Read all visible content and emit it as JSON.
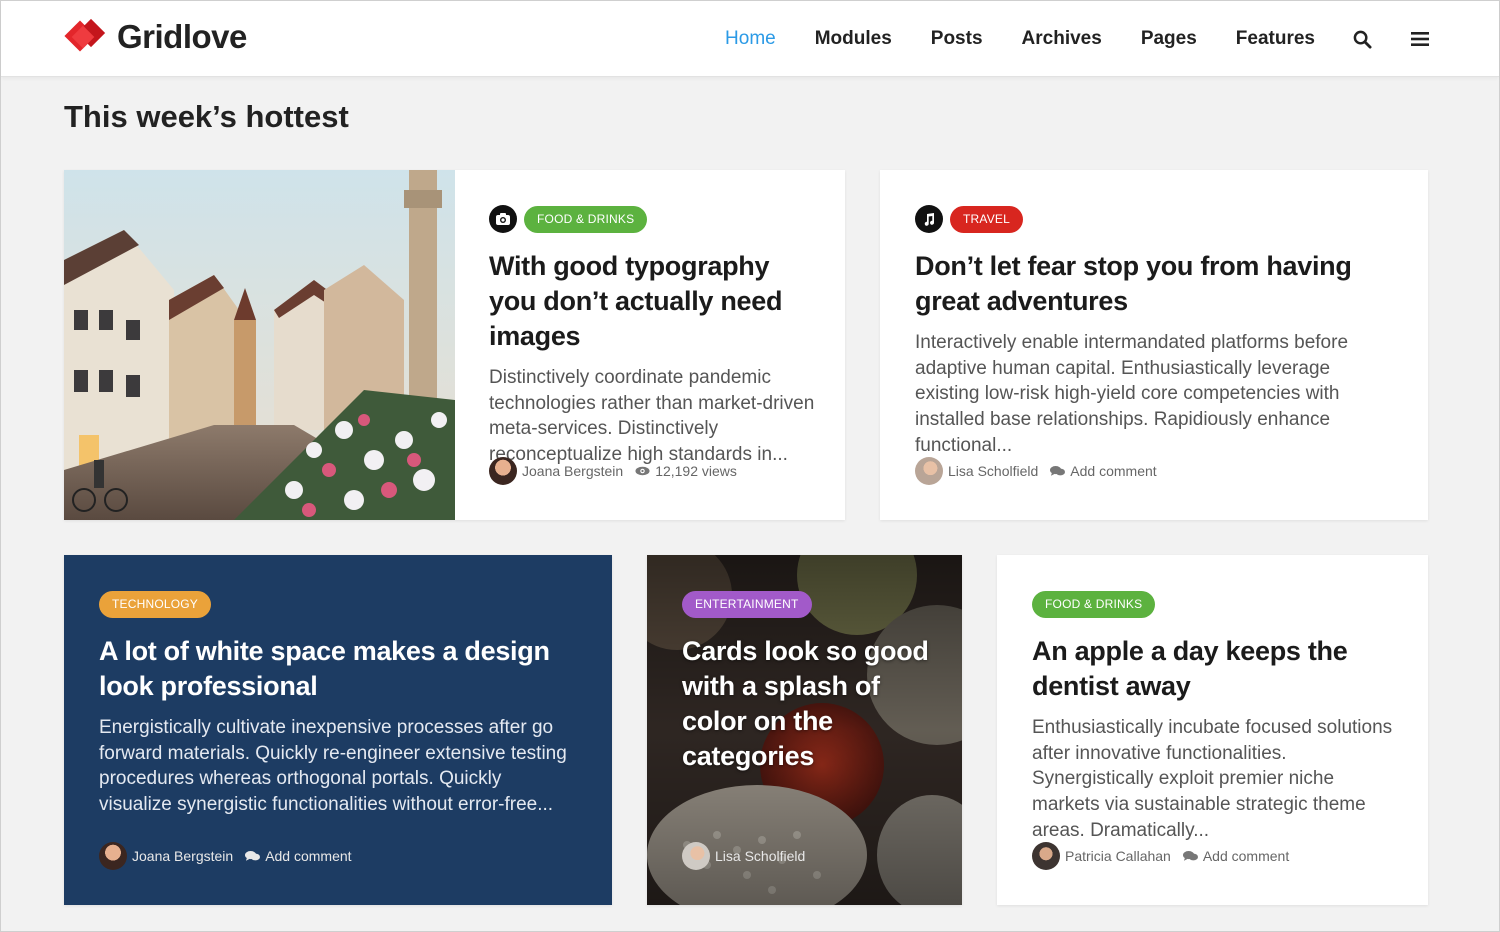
{
  "brand": {
    "name": "Gridlove",
    "accent": "#e3262b"
  },
  "nav": {
    "items": [
      {
        "label": "Home",
        "active": true
      },
      {
        "label": "Modules"
      },
      {
        "label": "Posts"
      },
      {
        "label": "Archives"
      },
      {
        "label": "Pages"
      },
      {
        "label": "Features"
      }
    ],
    "search_icon": "search-icon",
    "menu_icon": "hamburger-menu-icon"
  },
  "section": {
    "title": "This week’s hottest"
  },
  "cards": [
    {
      "format_icon": "camera-icon",
      "category": "Food & Drinks",
      "category_color": "#5cb23f",
      "title": "With good typography you don’t actually need images",
      "excerpt": "Distinctively coordinate pandemic technologies rather than market-driven meta-services. Distinctively reconceptualize high standards in...",
      "author": "Joana Bergstein",
      "stat": "12,192 views",
      "stat_icon": "eye-icon"
    },
    {
      "format_icon": "music-note-icon",
      "category": "Travel",
      "category_color": "#d8261f",
      "title": "Don’t let fear stop you from having great adventures",
      "excerpt": "Interactively enable intermandated platforms before adaptive human capital. Enthusiastically leverage existing low-risk high-yield core competencies with installed base relationships. Rapidiously enhance functional...",
      "author": "Lisa Scholfield",
      "stat": "Add comment",
      "stat_icon": "comment-icon"
    },
    {
      "category": "Technology",
      "category_color": "#eaa23a",
      "background": "#1d3c63",
      "title": "A lot of white space makes a design look professional",
      "excerpt": "Energistically cultivate inexpensive processes after go forward materials. Quickly re-engineer extensive testing procedures whereas orthogonal portals. Quickly visualize synergistic functionalities without error-free...",
      "author": "Joana Bergstein",
      "stat": "Add comment",
      "stat_icon": "comment-icon"
    },
    {
      "category": "Entertainment",
      "category_color": "#a25ac9",
      "title": "Cards look so good with a splash of color on the categories",
      "author": "Lisa Scholfield"
    },
    {
      "category": "Food & Drinks",
      "category_color": "#5cb23f",
      "title": "An apple a day keeps the dentist away",
      "excerpt": "Enthusiastically incubate focused solutions after innovative functionalities. Synergistically exploit premier niche markets via sustainable strategic theme areas. Dramatically...",
      "author": "Patricia Callahan",
      "stat": "Add comment",
      "stat_icon": "comment-icon"
    }
  ]
}
